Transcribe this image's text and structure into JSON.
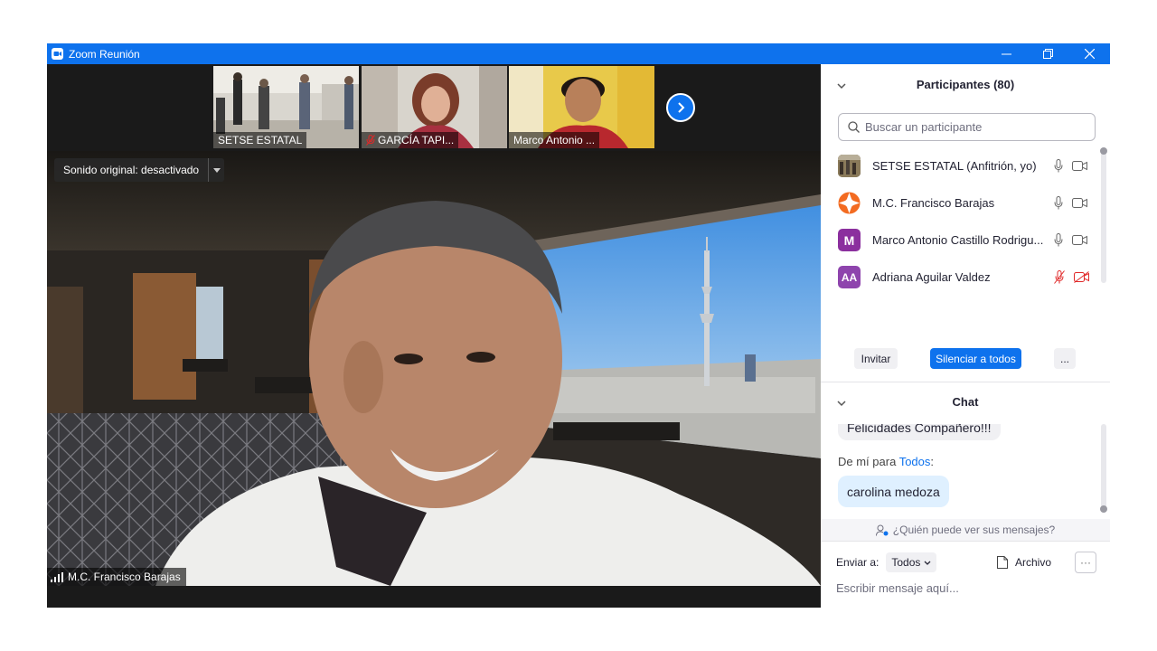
{
  "window": {
    "title": "Zoom Reunión"
  },
  "thumbnails": [
    {
      "name": "SETSE ESTATAL",
      "muted": false
    },
    {
      "name": "GARCÍA TAPI...",
      "muted": true
    },
    {
      "name": "Marco Antonio ...",
      "muted": false
    }
  ],
  "main_video": {
    "sound_label": "Sonido original: desactivado",
    "speaker_name": "M.C. Francisco Barajas"
  },
  "participants": {
    "header": "Participantes (80)",
    "search_placeholder": "Buscar un participante",
    "list": [
      {
        "name": "SETSE ESTATAL (Anfitrión, yo)",
        "avatar_text": "",
        "avatar_color": "#6b6048",
        "mic": "on",
        "video": "on"
      },
      {
        "name": "M.C. Francisco Barajas",
        "avatar_text": "",
        "avatar_color": "#ffffff",
        "mic": "on",
        "video": "on"
      },
      {
        "name": "Marco Antonio Castillo Rodrigu...",
        "avatar_text": "M",
        "avatar_color": "#8b2f9e",
        "mic": "on",
        "video": "on"
      },
      {
        "name": "Adriana Aguilar Valdez",
        "avatar_text": "AA",
        "avatar_color": "#8e44ad",
        "mic": "muted",
        "video": "off"
      }
    ],
    "buttons": {
      "invite": "Invitar",
      "mute_all": "Silenciar a todos",
      "more": "..."
    }
  },
  "chat": {
    "header": "Chat",
    "partial_message": "Felicidades Compañero!!!",
    "from_prefix": "De mí para ",
    "from_target": "Todos",
    "from_suffix": ":",
    "last_message": "carolina medoza",
    "who_sees": "¿Quién puede ver sus mensajes?",
    "send_to_label": "Enviar a:",
    "send_to_value": "Todos",
    "file_label": "Archivo",
    "more_label": "···",
    "input_placeholder": "Escribir mensaje aquí..."
  },
  "colors": {
    "accent": "#0e72ed",
    "mute_red": "#e02828"
  }
}
